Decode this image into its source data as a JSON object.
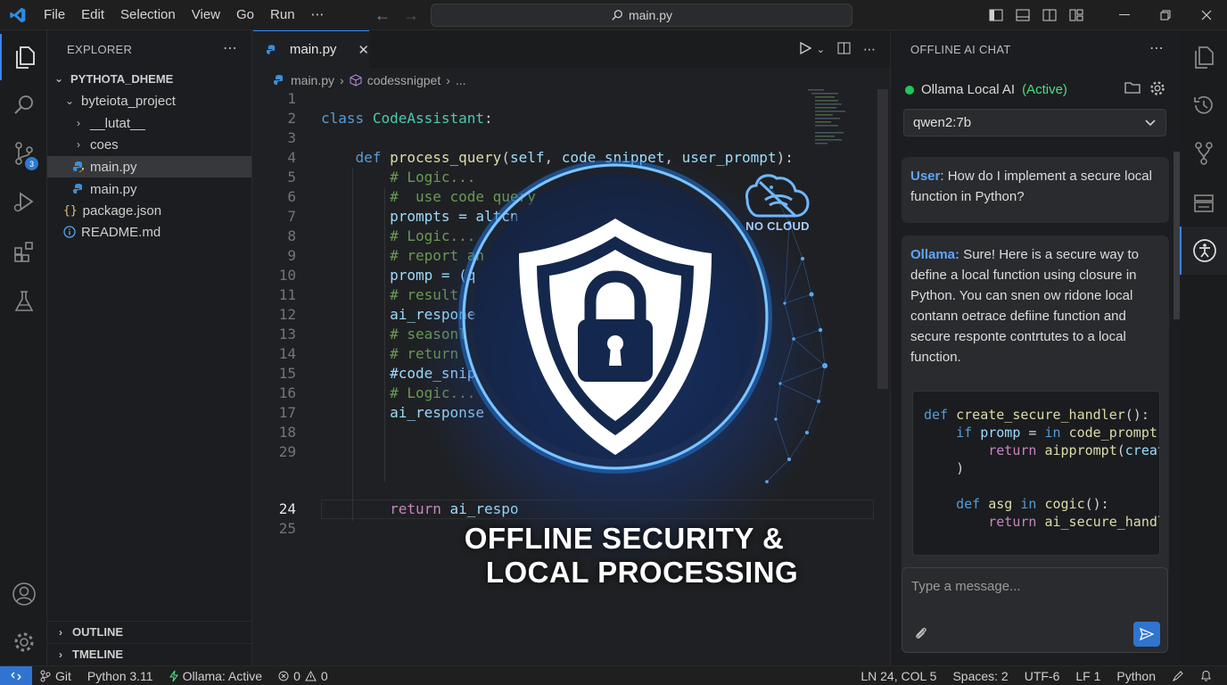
{
  "menu": [
    "File",
    "Edit",
    "Selection",
    "View",
    "Go",
    "Run",
    "⋯"
  ],
  "command_center": "main.py",
  "sidebar": {
    "title": "EXPLORER",
    "more": "⋯",
    "tree": [
      {
        "label": "PYTHOTA_DHEME",
        "kind": "root"
      },
      {
        "label": "byteiota_project",
        "kind": "folder"
      },
      {
        "label": "__lutat__",
        "kind": "folder-collapsed"
      },
      {
        "label": "coes",
        "kind": "folder-collapsed"
      },
      {
        "label": "main.py",
        "kind": "py",
        "selected": true
      },
      {
        "label": "main.py",
        "kind": "py"
      },
      {
        "label": "package.json",
        "kind": "json"
      },
      {
        "label": "README.md",
        "kind": "info"
      }
    ],
    "sections": [
      "OUTLINE",
      "TMELINE"
    ]
  },
  "scm_badge": "3",
  "editor": {
    "tab_label": "main.py",
    "breadcrumb": [
      "main.py",
      "codessnigpet",
      "..."
    ],
    "line_numbers": [
      "1",
      "2",
      "3",
      "4",
      "5",
      "6",
      "7",
      "8",
      "9",
      "10",
      "11",
      "12",
      "13",
      "14",
      "15",
      "16",
      "17",
      "18",
      "29",
      "24",
      "25"
    ],
    "code_lines": [
      "",
      "class CodeAssistant:",
      "",
      "    def process_query(self, code_snippet, user_prompt):",
      "        # Logic...",
      "        #  use code query",
      "        prompts = altcn",
      "        # Logic...",
      "        # report an",
      "        promp = (q",
      "        # result",
      "        ai_respone",
      "        # seasonl",
      "        # return",
      "        #code_snip",
      "        # Logic...",
      "        ai_response",
      "",
      "        return ai_respo",
      ""
    ]
  },
  "hero": {
    "line1": "OFFLINE SECURITY &",
    "line2": "LOCAL PROCESSING",
    "cloud_label": "NO CLOUD"
  },
  "chat": {
    "title": "OFFLINE AI CHAT",
    "more": "⋯",
    "status_name": "Ollama Local AI",
    "status_state": "(Active)",
    "model": "qwen2:7b",
    "user_who": "User",
    "user_text": "How do I implement a secure local function in Python?",
    "ai_who": "Ollama:",
    "ai_text": "Sure! Here is a secure way to define a local function using closure in Python. You can snen ow ridone local contann oetrace defiine function and secure responte contrtutes to a local function.",
    "code_lines": [
      "def create_secure_handler():",
      "    if promp = in code_prompt(",
      "        return aipprompt(create_",
      "    )",
      "",
      "    def asg in cogic():",
      "        return ai_secure_handler"
    ],
    "input_placeholder": "Type a message..."
  },
  "statusbar": {
    "git": "Git",
    "python": "Python 3.11",
    "ollama": "Ollama: Active",
    "errors": "0",
    "warnings": "0",
    "position": "LN 24, COL 5",
    "spaces": "Spaces: 2",
    "encoding": "UTF-6",
    "eol": "LF 1",
    "language": "Python"
  },
  "colors": {
    "accent": "#3b82f6",
    "active_green": "#22c55e",
    "glow_blue": "#3ea6ff"
  }
}
